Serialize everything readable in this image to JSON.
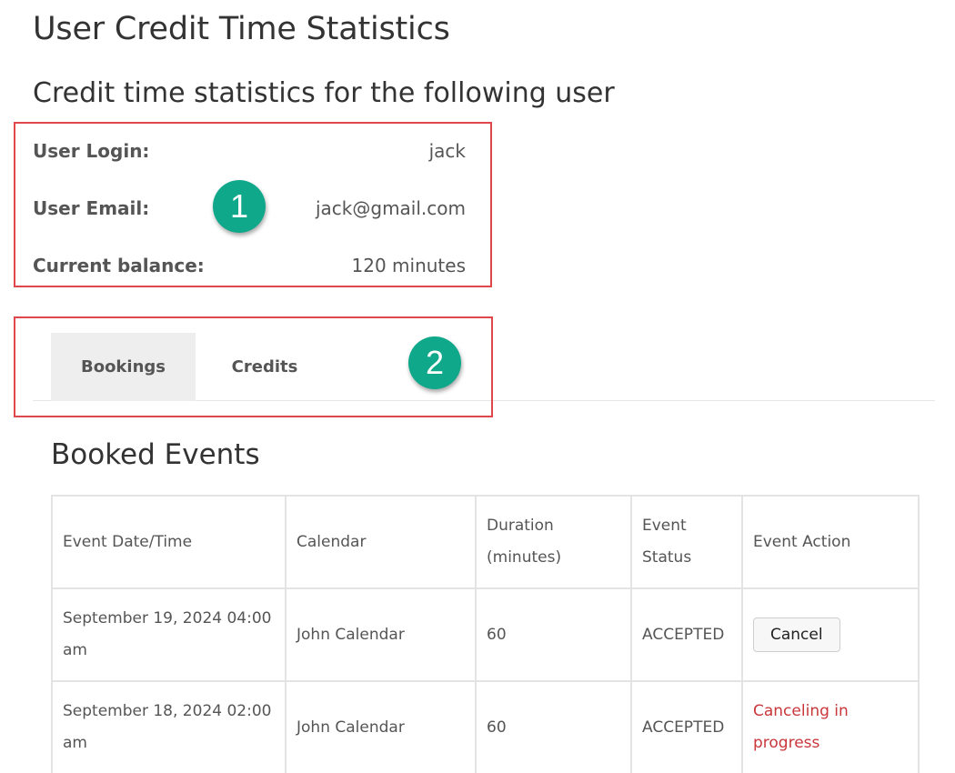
{
  "page": {
    "title": "User Credit Time Statistics",
    "subtitle": "Credit time statistics for the following user"
  },
  "user_info": {
    "login_label": "User Login:",
    "login_value": "jack",
    "email_label": "User Email:",
    "email_value": "jack@gmail.com",
    "balance_label": "Current balance:",
    "balance_value": "120 minutes"
  },
  "tabs": [
    {
      "label": "Bookings",
      "active": true
    },
    {
      "label": "Credits",
      "active": false
    }
  ],
  "annotations": {
    "badge1": "1",
    "badge2": "2",
    "highlight_color": "#e0474c",
    "badge_color": "#10a88a"
  },
  "booked_events": {
    "title": "Booked Events",
    "headers": [
      "Event Date/Time",
      "Calendar",
      "Duration (minutes)",
      "Event Status",
      "Event Action"
    ],
    "rows": [
      {
        "datetime": "September 19, 2024 04:00 am",
        "calendar": "John Calendar",
        "duration": "60",
        "status": "ACCEPTED",
        "action": "Cancel",
        "action_type": "button"
      },
      {
        "datetime": "September 18, 2024 02:00 am",
        "calendar": "John Calendar",
        "duration": "60",
        "status": "ACCEPTED",
        "action": "Canceling in progress",
        "action_type": "text"
      }
    ]
  }
}
